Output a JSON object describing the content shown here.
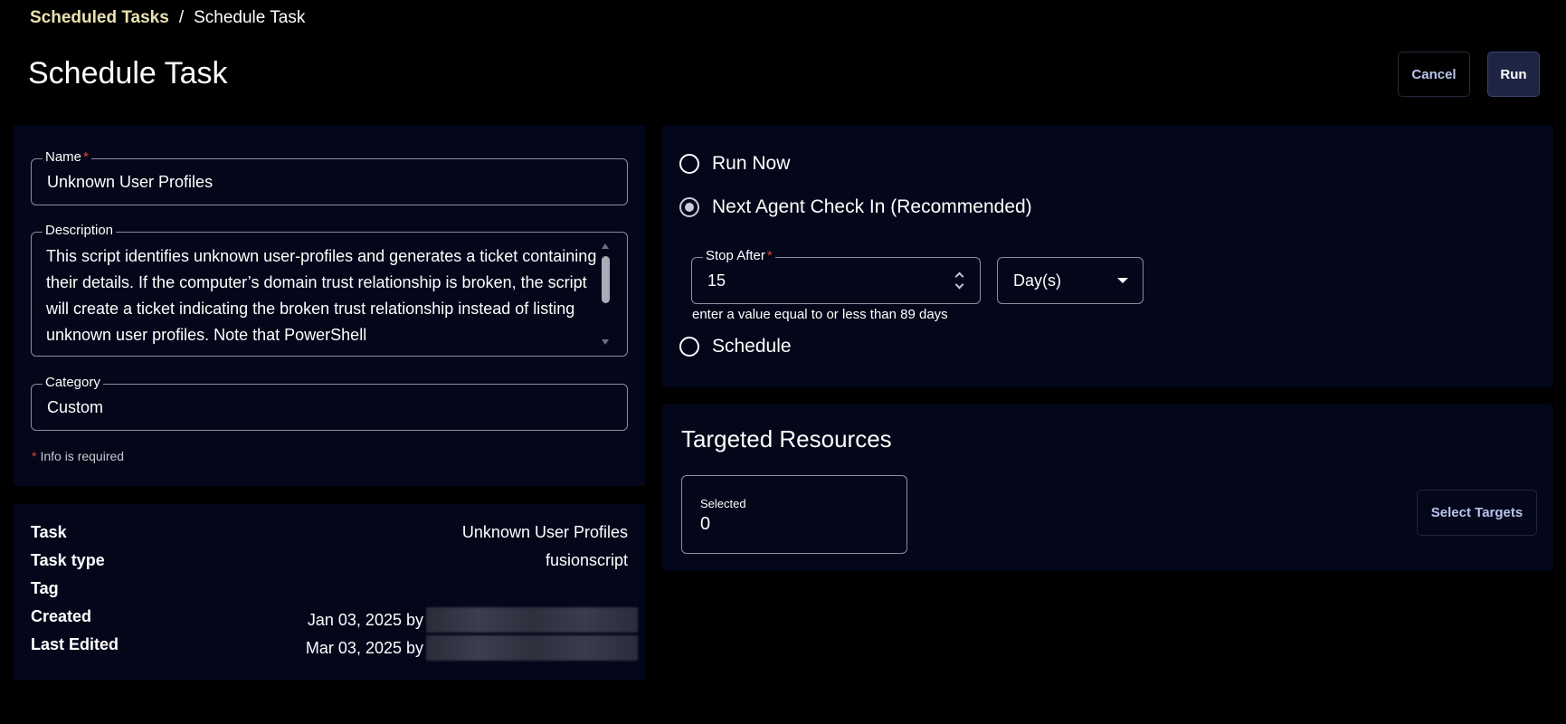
{
  "breadcrumb": {
    "parent": "Scheduled Tasks",
    "separator": "/",
    "current": "Schedule Task"
  },
  "header": {
    "title": "Schedule Task",
    "cancel_label": "Cancel",
    "run_label": "Run"
  },
  "form": {
    "name_label": "Name",
    "name_value": "Unknown User Profiles",
    "description_label": "Description",
    "description_value": "This script identifies unknown user-profiles and generates a ticket containing their details. If the computer’s domain trust relationship is broken, the script will create a ticket indicating the broken trust relationship instead of listing unknown user profiles. Note that PowerShell",
    "category_label": "Category",
    "category_value": "Custom",
    "required_star": "*",
    "info_required": "Info is required"
  },
  "meta": {
    "task_label": "Task",
    "task_value": "Unknown User Profiles",
    "task_type_label": "Task type",
    "task_type_value": "fusionscript",
    "tag_label": "Tag",
    "tag_value": "",
    "created_label": "Created",
    "created_value": "Jan 03, 2025 by",
    "last_edited_label": "Last Edited",
    "last_edited_value": "Mar 03, 2025 by"
  },
  "run_options": {
    "run_now": "Run Now",
    "next_agent": "Next Agent Check In (Recommended)",
    "schedule": "Schedule",
    "selected": "next_agent",
    "stop_after_label": "Stop After",
    "stop_after_value": "15",
    "unit_value": "Day(s)",
    "helper_text": "enter a value equal to or less than 89 days"
  },
  "targets": {
    "title": "Targeted Resources",
    "selected_label": "Selected",
    "selected_count": "0",
    "select_button": "Select Targets"
  },
  "colors": {
    "breadcrumb_link": "#e9e2b0",
    "required": "#e4403c",
    "panel_bg": "#04061a",
    "button_text": "#b8c4ec",
    "run_button_bg": "#1e2444"
  }
}
